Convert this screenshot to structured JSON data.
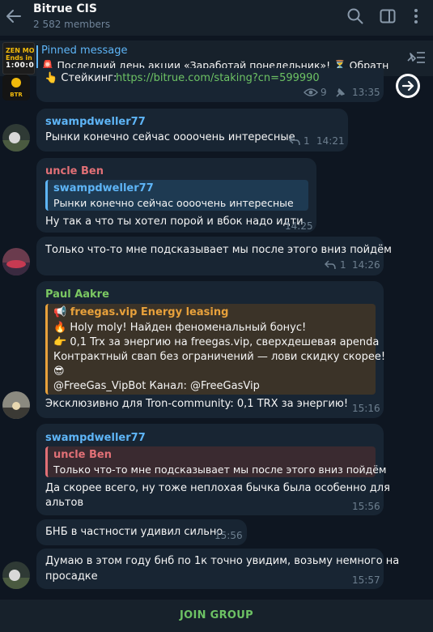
{
  "header": {
    "title": "Bitrue CIS",
    "members": "2 582 members"
  },
  "pinned": {
    "title": "Pinned message",
    "text": "🚨 Последний день акции «Заработай понедельник»! ⏳ Обратн...",
    "thumb_line1": "ZEN MONDI\nEnds in",
    "thumb_line2": "1:00:01"
  },
  "top_message": {
    "text_prefix": "👆 Стейкинг:",
    "link": "https://bitrue.com/staking?cn=599990",
    "views": "9",
    "time": "13:35"
  },
  "messages": [
    {
      "sender": "swampdweller77",
      "text": "Рынки конечно сейчас оооочень интересные",
      "replies": "1",
      "time": "14:21"
    },
    {
      "sender": "uncle Ben",
      "quote_sender": "swampdweller77",
      "quote_text": "Рынки конечно сейчас оооочень интересные",
      "text": "Ну так а что ты хотел порой и вбок надо идти",
      "time": "14:25"
    },
    {
      "text": "Только что-то мне подсказывает мы после этого вниз пойдём",
      "replies": "1",
      "time": "14:26"
    },
    {
      "sender": "Paul Aakre",
      "quote_sender": "📢 freegas.vip Energy leasing",
      "quote_lines": [
        "🔥 Holy moly! Найден феноменальный бонус!",
        "👉 0,1 Trx за энергию на freegas.vip, сверхдешевая apenda",
        "Контрактный свап без ограничений — лови скидку скорее!",
        "😎",
        "@FreeGas_VipBot  Канал: @FreeGasVip"
      ],
      "text": "Эксклюзивно для Tron-community: 0,1 TRX за энергию!",
      "time": "15:16"
    },
    {
      "sender": "swampdweller77",
      "quote_sender": "uncle Ben",
      "quote_text": "Только что-то мне подсказывает мы после этого вниз пойдём",
      "text_lines": [
        "Да скорее всего, ну тоже неплохая бычка была особенно для",
        "альтов"
      ],
      "time": "15:56"
    },
    {
      "text": "БНБ в частности удивил сильно",
      "time": "15:56"
    },
    {
      "text_lines": [
        "Думаю в этом году бнб по 1к точно увидим, возьму немного на",
        "просадке"
      ],
      "time": "15:57"
    }
  ],
  "footer": {
    "join_label": "JOIN GROUP"
  },
  "colors": {
    "background": "#0e1621",
    "bubble": "#182533",
    "accent_blue": "#5eb5f7",
    "sender_red": "#e17076",
    "sender_green": "#7bc862",
    "sender_orange": "#e8a13b",
    "join_green": "#6dc264"
  }
}
